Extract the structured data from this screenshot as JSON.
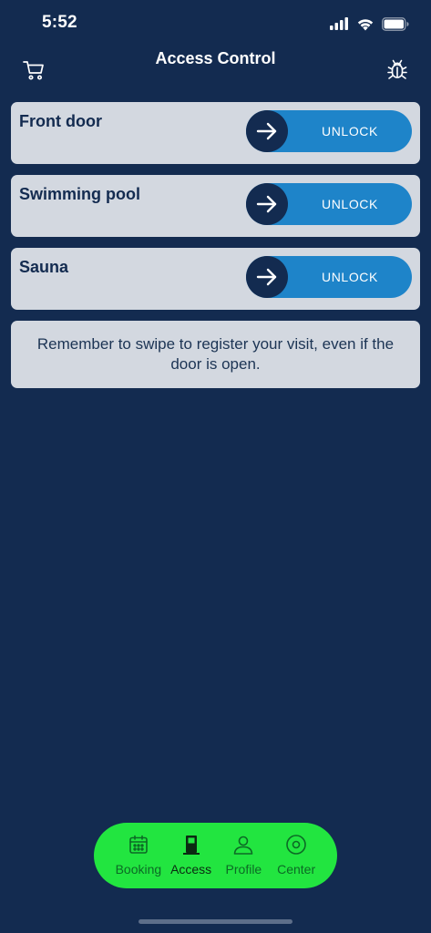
{
  "status_bar": {
    "time": "5:52"
  },
  "header": {
    "title": "Access Control",
    "cart_icon": "cart-icon",
    "bug_icon": "bug-icon"
  },
  "access_points": [
    {
      "name": "Front door",
      "action_label": "UNLOCK"
    },
    {
      "name": "Swimming pool",
      "action_label": "UNLOCK"
    },
    {
      "name": "Sauna",
      "action_label": "UNLOCK"
    }
  ],
  "notice": {
    "text": "Remember to swipe to register your visit, even if the door is open."
  },
  "bottom_nav": {
    "items": [
      {
        "label": "Booking",
        "icon": "calendar-icon",
        "active": false
      },
      {
        "label": "Access",
        "icon": "door-icon",
        "active": true
      },
      {
        "label": "Profile",
        "icon": "person-icon",
        "active": false
      },
      {
        "label": "Center",
        "icon": "target-icon",
        "active": false
      }
    ]
  },
  "colors": {
    "background": "#132b50",
    "card": "#d3d8e0",
    "unlock_slider": "#1e84c9",
    "nav_pill": "#22e540"
  }
}
